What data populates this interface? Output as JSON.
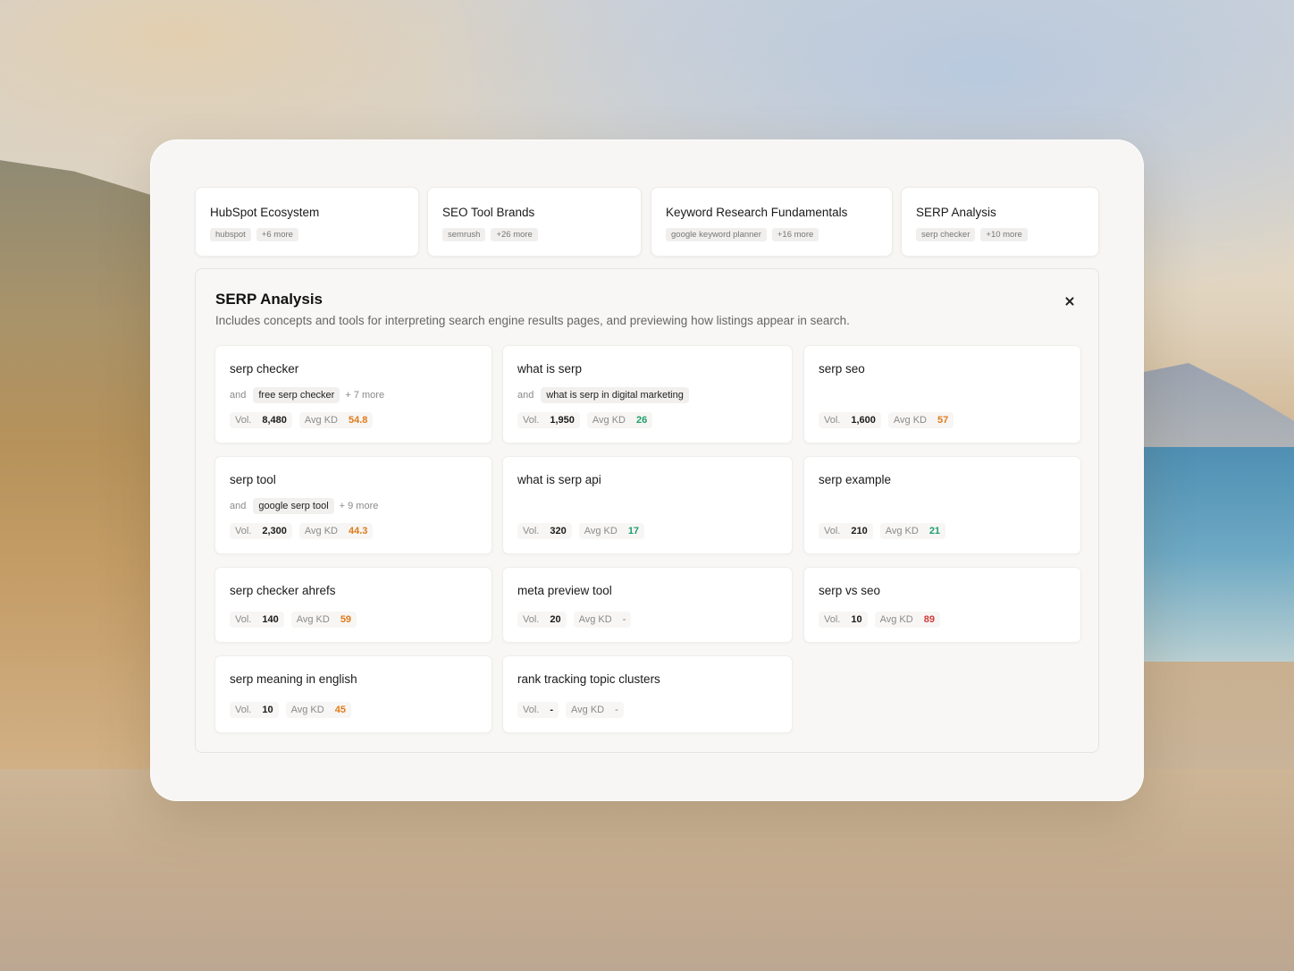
{
  "tabs": [
    {
      "title": "HubSpot Ecosystem",
      "chips": [
        "hubspot",
        "+6 more"
      ]
    },
    {
      "title": "SEO Tool Brands",
      "chips": [
        "semrush",
        "+26 more"
      ]
    },
    {
      "title": "Keyword Research Fundamentals",
      "chips": [
        "google keyword planner",
        "+16 more"
      ]
    },
    {
      "title": "SERP Analysis",
      "chips": [
        "serp checker",
        "+10 more"
      ]
    }
  ],
  "detail": {
    "title": "SERP Analysis",
    "description": "Includes concepts and tools for interpreting search engine results pages, and previewing how listings appear in search.",
    "vol_label": "Vol.",
    "kd_label": "Avg KD",
    "and_label": "and",
    "cards": [
      {
        "keyword": "serp checker",
        "related": "free serp checker",
        "more": "+ 7 more",
        "vol": "8,480",
        "kd": "54.8",
        "kd_color": "orange"
      },
      {
        "keyword": "what is serp",
        "related": "what is serp in digital marketing",
        "more": "",
        "vol": "1,950",
        "kd": "26",
        "kd_color": "green"
      },
      {
        "keyword": "serp seo",
        "related": "",
        "more": "",
        "vol": "1,600",
        "kd": "57",
        "kd_color": "orange"
      },
      {
        "keyword": "serp tool",
        "related": "google serp tool",
        "more": "+ 9 more",
        "vol": "2,300",
        "kd": "44.3",
        "kd_color": "orange"
      },
      {
        "keyword": "what is serp api",
        "related": "",
        "more": "",
        "vol": "320",
        "kd": "17",
        "kd_color": "green"
      },
      {
        "keyword": "serp example",
        "related": "",
        "more": "",
        "vol": "210",
        "kd": "21",
        "kd_color": "green"
      },
      {
        "keyword": "serp checker ahrefs",
        "related": "",
        "more": "",
        "vol": "140",
        "kd": "59",
        "kd_color": "orange"
      },
      {
        "keyword": "meta preview tool",
        "related": "",
        "more": "",
        "vol": "20",
        "kd": "-",
        "kd_color": "dash"
      },
      {
        "keyword": "serp vs seo",
        "related": "",
        "more": "",
        "vol": "10",
        "kd": "89",
        "kd_color": "red"
      },
      {
        "keyword": "serp meaning in english",
        "related": "",
        "more": "",
        "vol": "10",
        "kd": "45",
        "kd_color": "orange"
      },
      {
        "keyword": "rank tracking topic clusters",
        "related": "",
        "more": "",
        "vol": "-",
        "kd": "-",
        "kd_color": "dash"
      }
    ]
  },
  "colors": {
    "kd_orange": "#e07b1a",
    "kd_green": "#1e9e6a",
    "kd_red": "#d43a3a"
  },
  "icons": {
    "close": "close-icon"
  }
}
